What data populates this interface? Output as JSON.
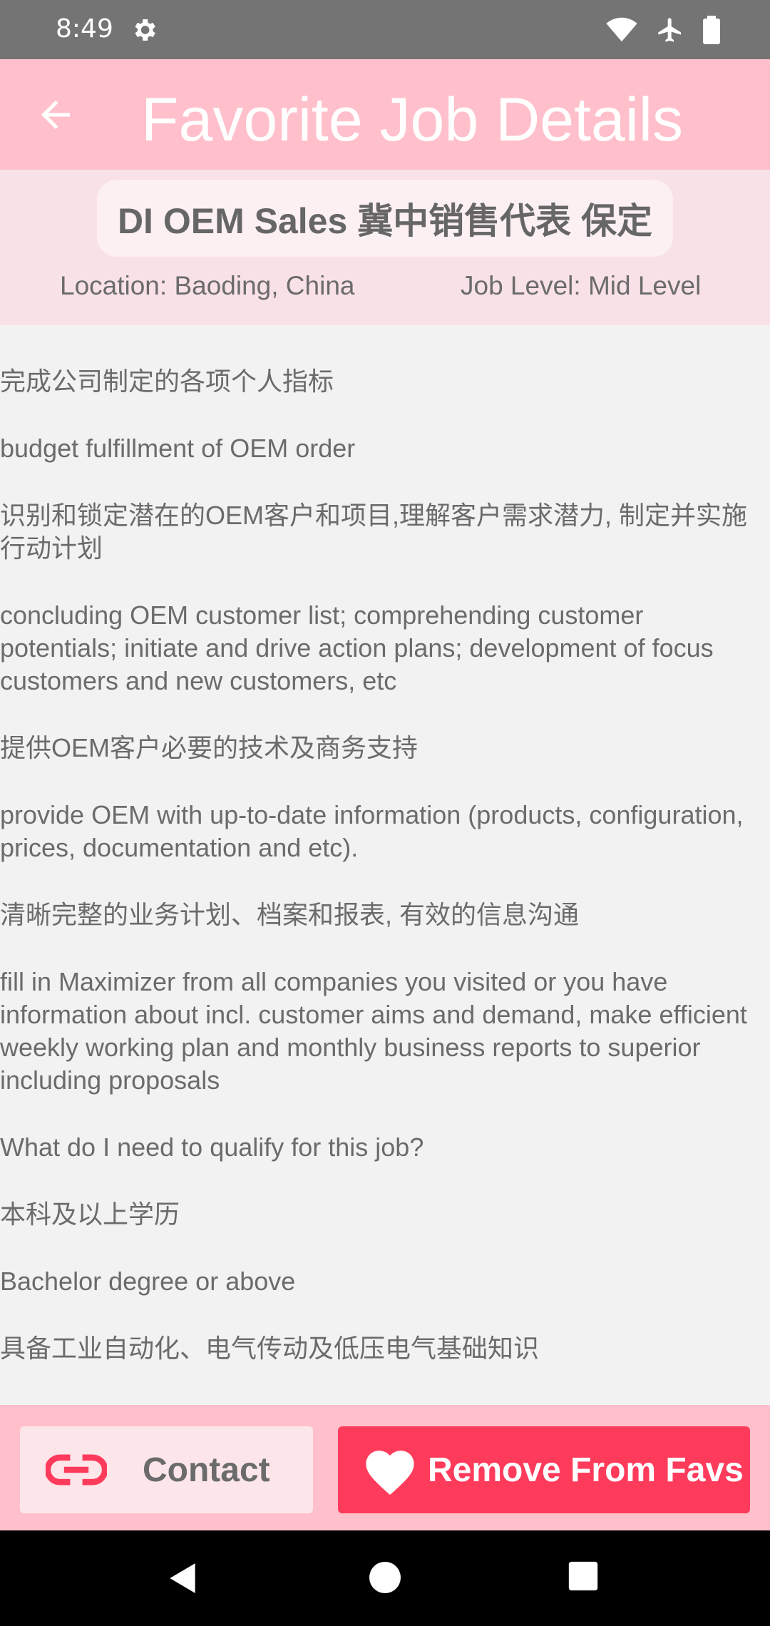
{
  "status_bar": {
    "time": "8:49"
  },
  "app_bar": {
    "title": "Favorite Job Details"
  },
  "job": {
    "title": "DI OEM Sales 冀中销售代表 保定",
    "location": "Location: Baoding, China",
    "level": "Job Level: Mid Level"
  },
  "description": {
    "paragraphs": [
      "完成公司制定的各项个人指标",
      "budget fulfillment of OEM order",
      "识别和锁定潜在的OEM客户和项目,理解客户需求潜力, 制定并实施行动计划",
      "concluding OEM customer list; comprehending customer potentials; initiate and drive action plans; development of focus customers and new customers, etc",
      "提供OEM客户必要的技术及商务支持",
      "provide OEM with up-to-date information (products, configuration, prices, documentation and etc).",
      "清晰完整的业务计划、档案和报表, 有效的信息沟通",
      "fill in Maximizer from all companies you visited or you have information about incl. customer aims and demand, make efficient weekly working plan and monthly business reports to superior including proposals",
      "What do I need to qualify for this job?",
      "本科及以上学历",
      "Bachelor degree or above",
      "具备工业自动化、电气传动及低压电气基础知识"
    ]
  },
  "actions": {
    "contact_label": "Contact",
    "remove_label": "Remove From Favs"
  },
  "colors": {
    "app_bar": "#ffc0cb",
    "accent_red": "#ff3b5c",
    "header_bg": "#f9e2e7"
  }
}
